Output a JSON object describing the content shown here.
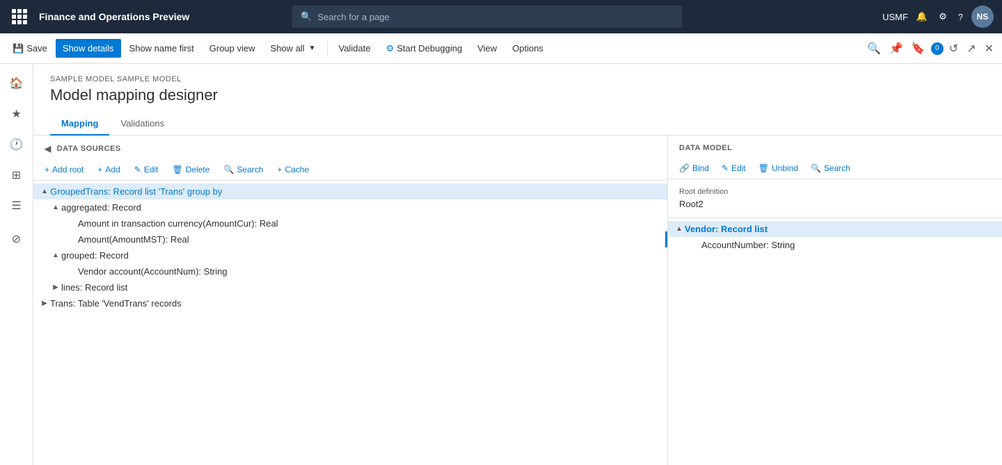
{
  "app": {
    "title": "Finance and Operations Preview",
    "search_placeholder": "Search for a page",
    "user": "USMF",
    "avatar": "NS"
  },
  "commandBar": {
    "save": "Save",
    "showDetails": "Show details",
    "showNameFirst": "Show name first",
    "groupView": "Group view",
    "showAll": "Show all",
    "validate": "Validate",
    "startDebugging": "Start Debugging",
    "view": "View",
    "options": "Options"
  },
  "sidebar": {
    "icons": [
      "home",
      "star",
      "clock",
      "grid",
      "list"
    ]
  },
  "page": {
    "breadcrumb": "SAMPLE MODEL SAMPLE MODEL",
    "title": "Model mapping designer",
    "tabs": [
      {
        "label": "Mapping",
        "active": true
      },
      {
        "label": "Validations",
        "active": false
      }
    ]
  },
  "dataSourcesPanel": {
    "title": "DATA SOURCES",
    "toolbar": {
      "addRoot": "+ Add root",
      "add": "+ Add",
      "edit": "✎ Edit",
      "delete": "🗑 Delete",
      "search": "Search",
      "cache": "+ Cache"
    },
    "tree": [
      {
        "id": 1,
        "label": "GroupedTrans: Record list 'Trans' group by",
        "indent": 0,
        "expanded": true,
        "selected": true,
        "toggle": "▲",
        "hasIndicator": false,
        "children": [
          {
            "id": 2,
            "label": "aggregated: Record",
            "indent": 1,
            "expanded": true,
            "toggle": "▲",
            "hasIndicator": false,
            "children": [
              {
                "id": 3,
                "label": "Amount in transaction currency(AmountCur): Real",
                "indent": 2,
                "expanded": false,
                "toggle": "",
                "hasIndicator": false,
                "children": []
              },
              {
                "id": 4,
                "label": "Amount(AmountMST): Real",
                "indent": 2,
                "expanded": false,
                "toggle": "",
                "hasIndicator": true,
                "children": []
              }
            ]
          },
          {
            "id": 5,
            "label": "grouped: Record",
            "indent": 1,
            "expanded": true,
            "toggle": "▲",
            "hasIndicator": false,
            "children": [
              {
                "id": 6,
                "label": "Vendor account(AccountNum): String",
                "indent": 2,
                "expanded": false,
                "toggle": "",
                "hasIndicator": false,
                "children": []
              }
            ]
          },
          {
            "id": 7,
            "label": "lines: Record list",
            "indent": 1,
            "expanded": false,
            "toggle": "▶",
            "hasIndicator": false,
            "children": []
          }
        ]
      },
      {
        "id": 8,
        "label": "Trans: Table 'VendTrans' records",
        "indent": 0,
        "expanded": false,
        "toggle": "▶",
        "hasIndicator": false,
        "children": []
      }
    ]
  },
  "dataModelPanel": {
    "title": "DATA MODEL",
    "toolbar": {
      "bind": "Bind",
      "edit": "Edit",
      "unbind": "Unbind",
      "search": "Search"
    },
    "rootDefinition": {
      "label": "Root definition",
      "value": "Root2"
    },
    "tree": [
      {
        "id": 1,
        "label": "Vendor: Record list",
        "indent": 0,
        "expanded": true,
        "toggle": "▲",
        "selected": true,
        "children": [
          {
            "id": 2,
            "label": "AccountNumber: String",
            "indent": 1,
            "expanded": false,
            "toggle": "",
            "selected": false,
            "children": []
          }
        ]
      }
    ]
  }
}
